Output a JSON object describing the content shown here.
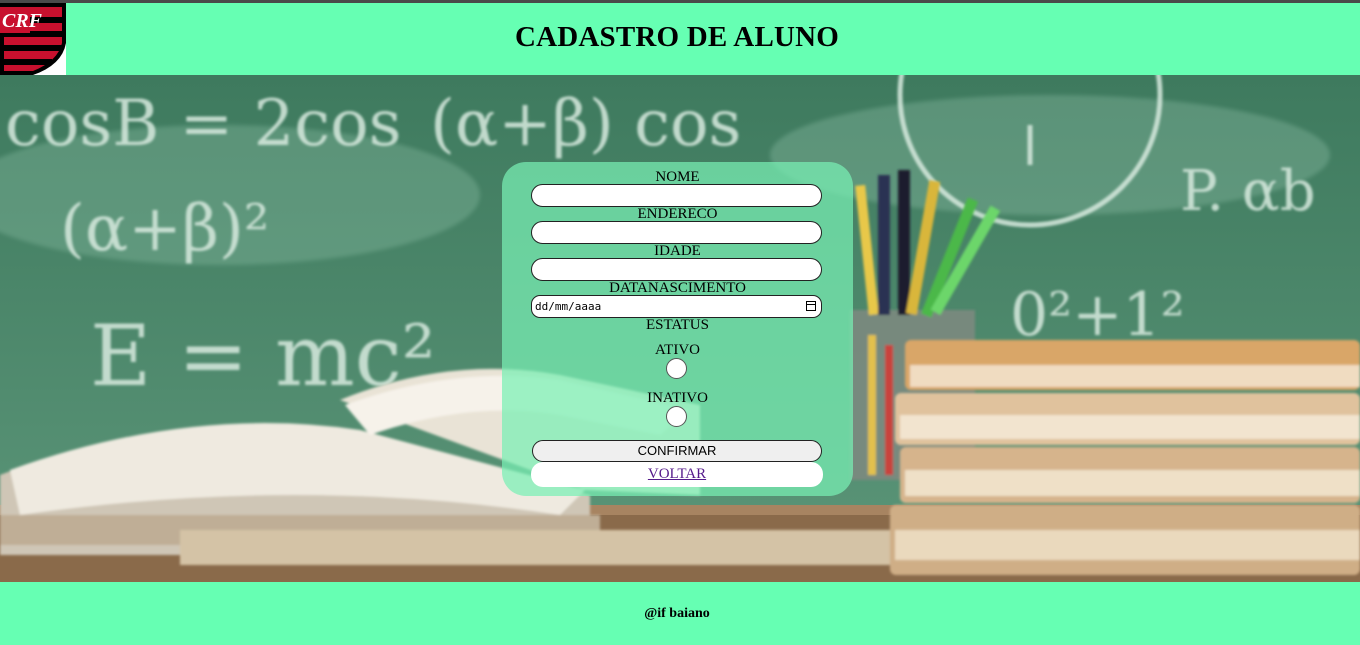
{
  "header": {
    "title": "CADASTRO DE ALUNO",
    "logo_icon": "flamengo-crest-icon",
    "logo_monogram": "CRF",
    "background_color": "#66ffb3"
  },
  "form": {
    "nome_label": "NOME",
    "nome_value": "",
    "endereco_label": "ENDERECO",
    "endereco_value": "",
    "idade_label": "IDADE",
    "idade_value": "",
    "datanascimento_label": "DATANASCIMENTO",
    "datanascimento_placeholder": "dd/mm/aaaa",
    "estatus_label": "ESTATUS",
    "ativo_label": "ATIVO",
    "inativo_label": "INATIVO",
    "confirm_button": "CONFIRMAR",
    "back_link": "VOLTAR"
  },
  "hero": {
    "chalkboard_formulas": [
      "cosB = 2cos",
      "(α+β) cos",
      "(α+β)²",
      "E = mc²",
      "0²+1²",
      "P. αb"
    ]
  },
  "footer": {
    "text": "@if baiano"
  }
}
